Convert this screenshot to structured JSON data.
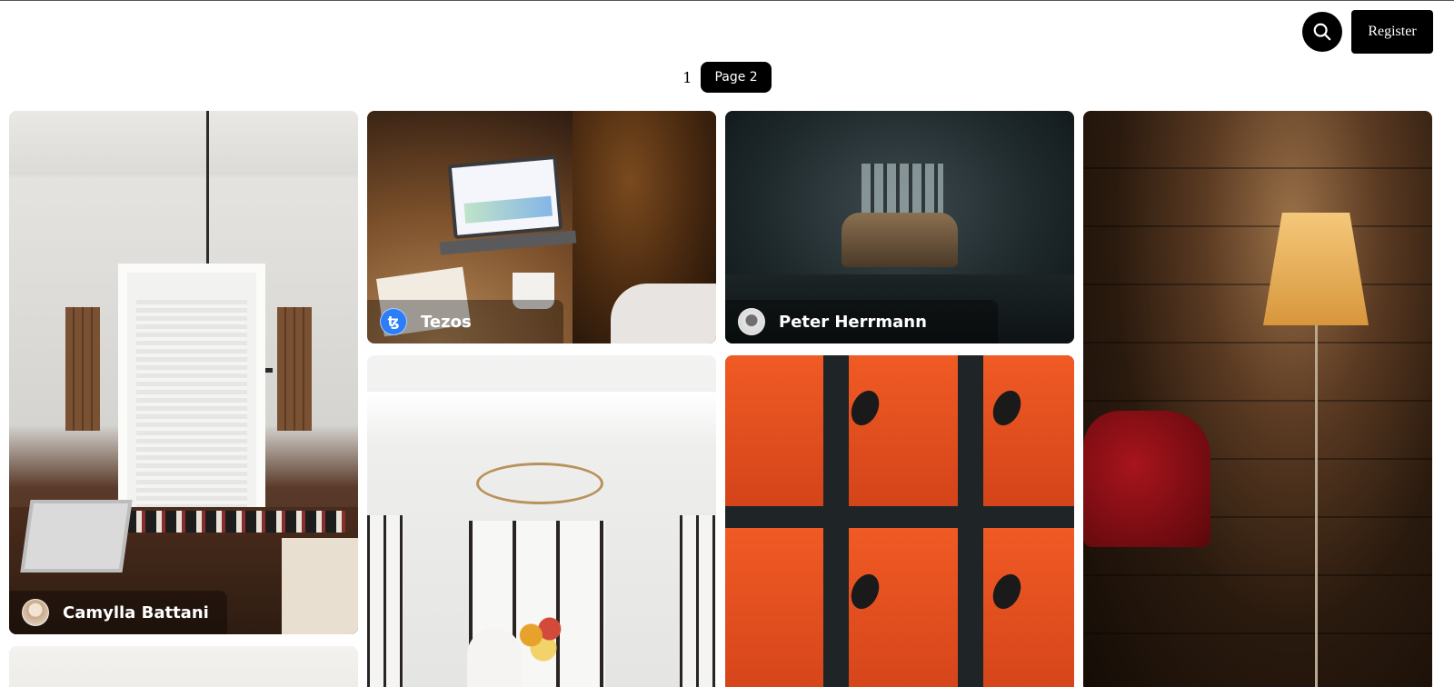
{
  "header": {
    "search_icon": "search-icon",
    "register_label": "Register"
  },
  "pagination": {
    "prev_page": "1",
    "current_page": "Page 2"
  },
  "tiles": [
    {
      "credit": "Camylla Battani",
      "avatar_color": "#d9c7b4"
    },
    {
      "credit": "Tezos",
      "avatar_color": "#2c7df7",
      "avatar_icon": "tezos-logo-icon"
    },
    {
      "credit": "Peter Herrmann",
      "avatar_color": "#c9c9c9"
    },
    {
      "credit": ""
    },
    {
      "credit": ""
    },
    {
      "credit": ""
    },
    {
      "credit": ""
    }
  ],
  "colors": {
    "button_bg": "#000000",
    "button_text": "#ffffff",
    "tezos_blue": "#2c7df7"
  }
}
